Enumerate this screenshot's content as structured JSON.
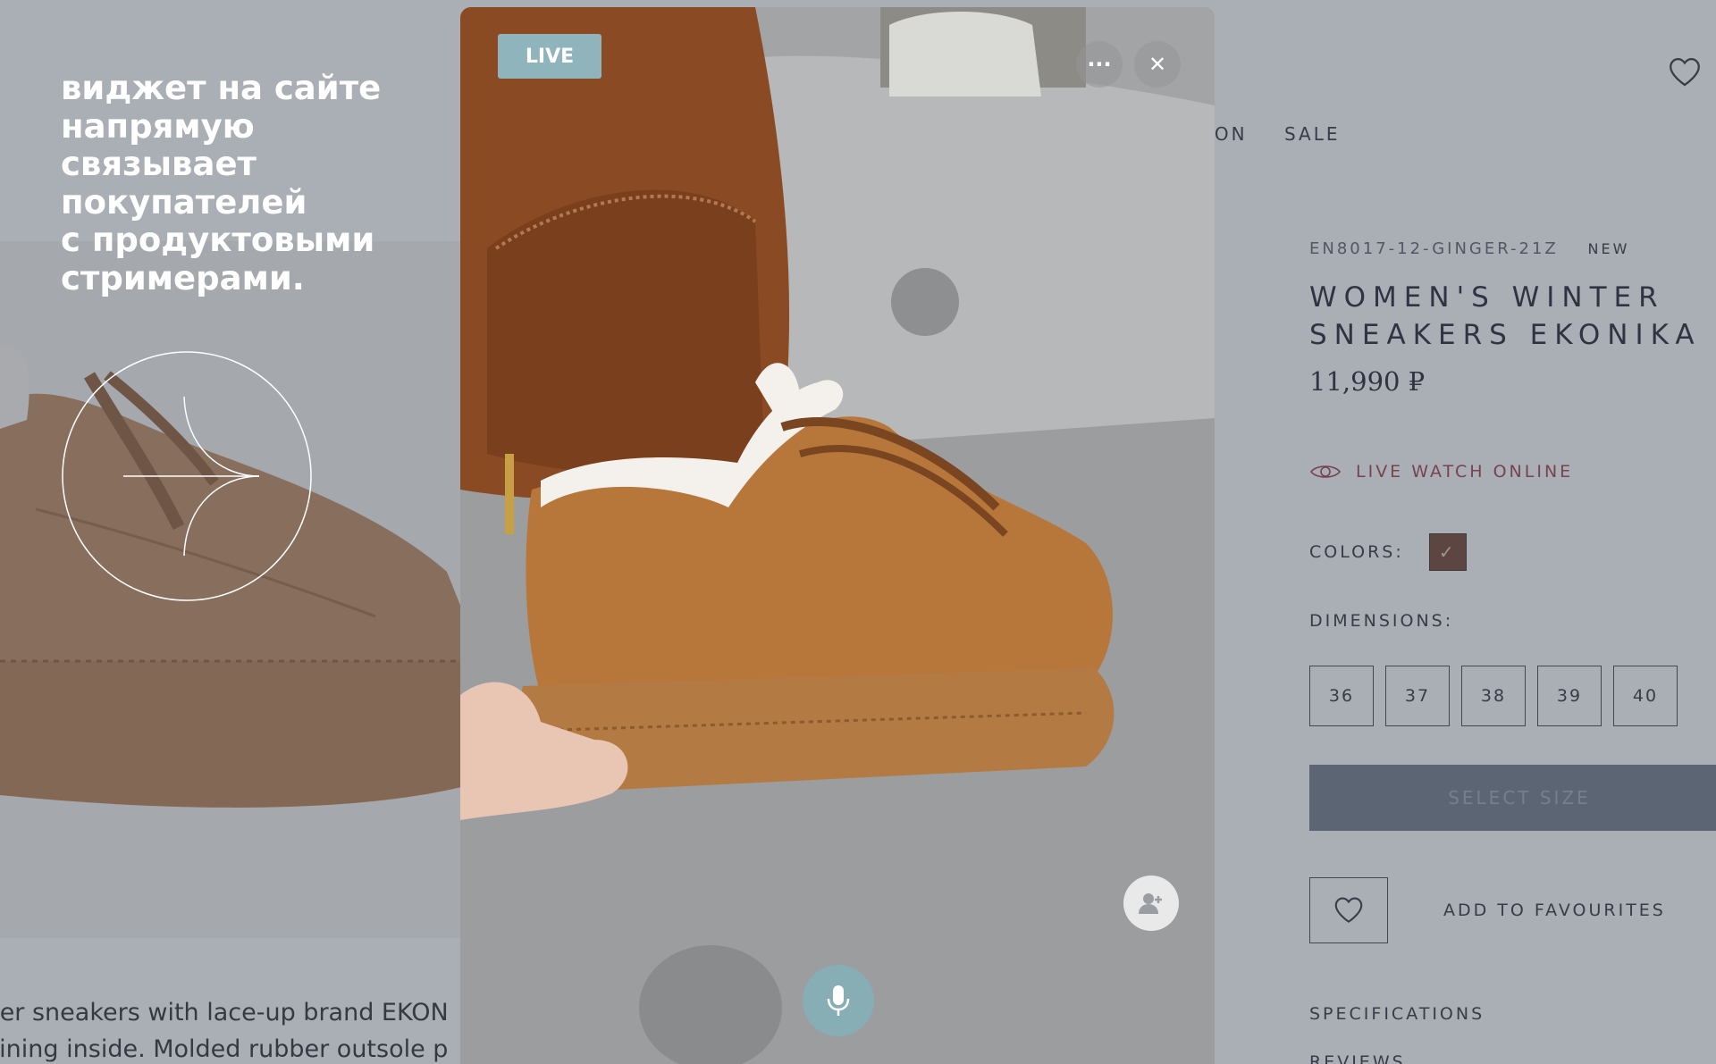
{
  "promo_text": {
    "lines": [
      "виджет на сайте",
      "напрямую",
      "связывает",
      "покупателей",
      "с продуктовыми",
      "стримерами."
    ]
  },
  "nav": {
    "items": [
      "ION",
      "SALE"
    ]
  },
  "product": {
    "sku": "EN8017-12-GINGER-21Z",
    "badge": "NEW",
    "title_line1": "WOMEN'S WINTER",
    "title_line2": "SNEAKERS EKONIKA",
    "price": "11,990 ₽",
    "live_watch_label": "LIVE WATCH ONLINE",
    "colors_label": "COLORS:",
    "color_swatch": "#6e3f2c",
    "dimensions_label": "DIMENSIONS:",
    "sizes": [
      "36",
      "37",
      "38",
      "39",
      "40"
    ],
    "select_size_label": "SELECT SIZE",
    "add_to_favourites_label": "ADD TO FAVOURITES",
    "specifications_label": "SPECIFICATIONS",
    "reviews_label": "REVIEWS",
    "description_line1": "nter sneakers with lace-up brand EKON",
    "description_line2": "r lining inside. Molded rubber outsole p"
  },
  "widget": {
    "live_label": "LIVE",
    "more_label": "···",
    "close_label": "✕",
    "accent": "#8fb4bb"
  },
  "icons": {
    "wishlist_top": "heart-icon",
    "eye": "eye-icon",
    "fav": "heart-icon",
    "invite": "add-user-icon",
    "mic": "microphone-icon",
    "arrow": "arrow-right-icon"
  }
}
